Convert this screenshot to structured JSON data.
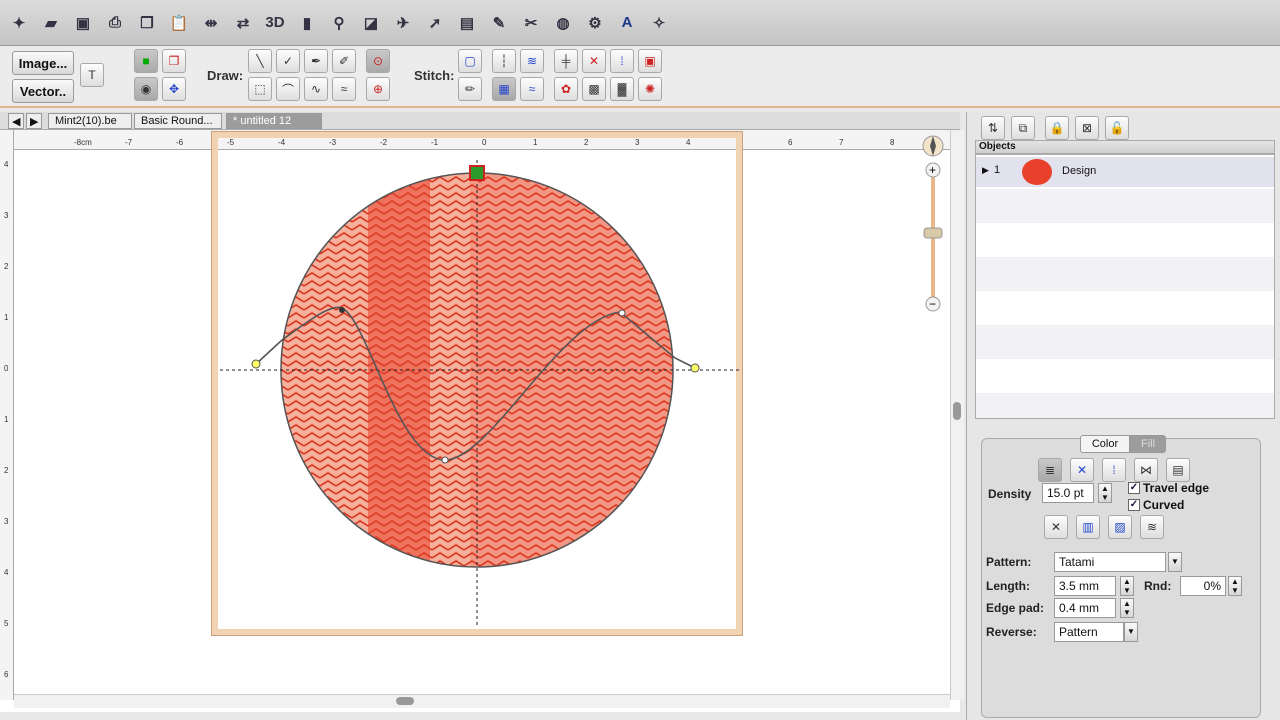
{
  "toolbar": {
    "image_button": "Image...",
    "vector_button": "Vector..",
    "draw_label": "Draw:",
    "stitch_label": "Stitch:",
    "icons": [
      "new",
      "open",
      "save",
      "print",
      "copy",
      "paste",
      "mirror",
      "flip",
      "3d",
      "chart",
      "zoom",
      "ruler",
      "airplane",
      "pointer",
      "window",
      "thread",
      "needle",
      "palette",
      "settings",
      "text",
      "font"
    ]
  },
  "tabs": [
    {
      "label": "Mint2(10).be"
    },
    {
      "label": "Basic Round..."
    },
    {
      "label": "* untitled 12"
    }
  ],
  "ruler": {
    "h_ticks": [
      "-8cm",
      "-7",
      "-6",
      "-5",
      "-4",
      "-3",
      "-2",
      "-1",
      "0",
      "1",
      "2",
      "3",
      "4",
      "5",
      "6",
      "7",
      "8"
    ],
    "v_ticks": [
      "4",
      "3",
      "2",
      "1",
      "0",
      "1",
      "2",
      "3",
      "4",
      "5",
      "6"
    ]
  },
  "objects": {
    "header": "Objects",
    "rows": [
      {
        "index": "1",
        "name": "Design",
        "color": "#e8402a"
      }
    ]
  },
  "properties": {
    "tab_color": "Color",
    "tab_fill": "Fill",
    "density_label": "Density",
    "density_value": "15.0 pt",
    "travel_edge_label": "Travel edge",
    "curved_label": "Curved",
    "pattern_label": "Pattern:",
    "pattern_value": "Tatami",
    "length_label": "Length:",
    "length_value": "3.5 mm",
    "rnd_label": "Rnd:",
    "rnd_value": "0%",
    "edge_pad_label": "Edge pad:",
    "edge_pad_value": "0.4 mm",
    "reverse_label": "Reverse:",
    "reverse_value": "Pattern"
  },
  "colors": {
    "stitch_fill": "#e8402a",
    "hoop": "#f1d3b4"
  }
}
